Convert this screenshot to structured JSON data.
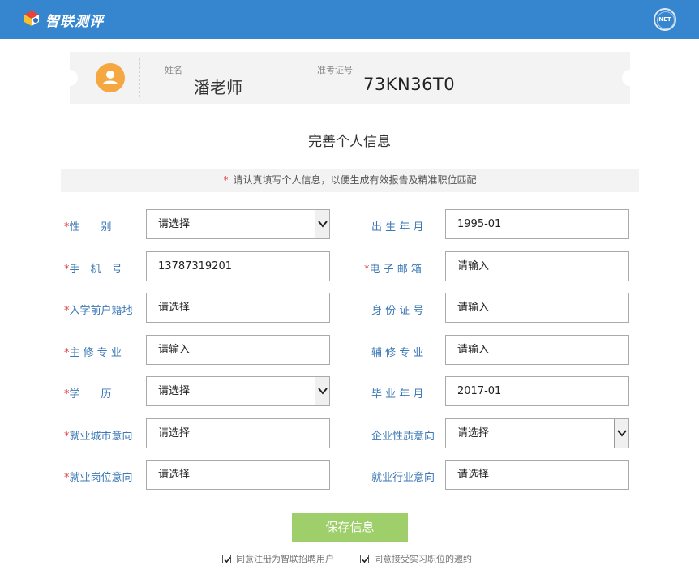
{
  "header": {
    "brand": "智联测评",
    "badge": "NET",
    "bg_color": "#3585cf"
  },
  "ticket": {
    "name_label": "姓名",
    "name": "潘老师",
    "id_label": "准考证号",
    "exam_id": "73KN36T0",
    "avatar_icon": "user-icon"
  },
  "section_title": "完善个人信息",
  "notice": {
    "star": "*",
    "text": "请认真填写个人信息，以便生成有效报告及精准职位匹配"
  },
  "form": {
    "left": [
      {
        "label": "性　　别",
        "required": true,
        "value": "请选择",
        "type": "select"
      },
      {
        "label": "手　机　号",
        "required": true,
        "value": "13787319201",
        "type": "input"
      },
      {
        "label": "入学前户籍地",
        "required": true,
        "value": "请选择",
        "type": "input"
      },
      {
        "label": "主 修 专 业",
        "required": true,
        "value": "请输入",
        "type": "input"
      },
      {
        "label": "学　　历",
        "required": true,
        "value": "请选择",
        "type": "select"
      },
      {
        "label": "就业城市意向",
        "required": true,
        "value": "请选择",
        "type": "input"
      },
      {
        "label": "就业岗位意向",
        "required": true,
        "value": "请选择",
        "type": "input"
      }
    ],
    "right": [
      {
        "label": "出 生 年 月",
        "required": false,
        "value": "1995-01",
        "type": "input"
      },
      {
        "label": "电 子 邮 箱",
        "required": true,
        "value": "请输入",
        "type": "input"
      },
      {
        "label": "身 份 证 号",
        "required": false,
        "value": "请输入",
        "type": "input"
      },
      {
        "label": "辅 修 专 业",
        "required": false,
        "value": "请输入",
        "type": "input"
      },
      {
        "label": "毕 业 年 月",
        "required": false,
        "value": "2017-01",
        "type": "input"
      },
      {
        "label": "企业性质意向",
        "required": false,
        "value": "请选择",
        "type": "select"
      },
      {
        "label": "就业行业意向",
        "required": false,
        "value": "请选择",
        "type": "input"
      }
    ]
  },
  "save_button": "保存信息",
  "agreements": [
    {
      "label": "同意注册为智联招聘用户",
      "checked": true
    },
    {
      "label": "同意接受实习职位的邀约",
      "checked": true
    }
  ],
  "colors": {
    "accent": "#3585cf",
    "label": "#3c78b6",
    "required": "#e23d3d",
    "save": "#9ecf6b",
    "avatar": "#f5a742"
  }
}
